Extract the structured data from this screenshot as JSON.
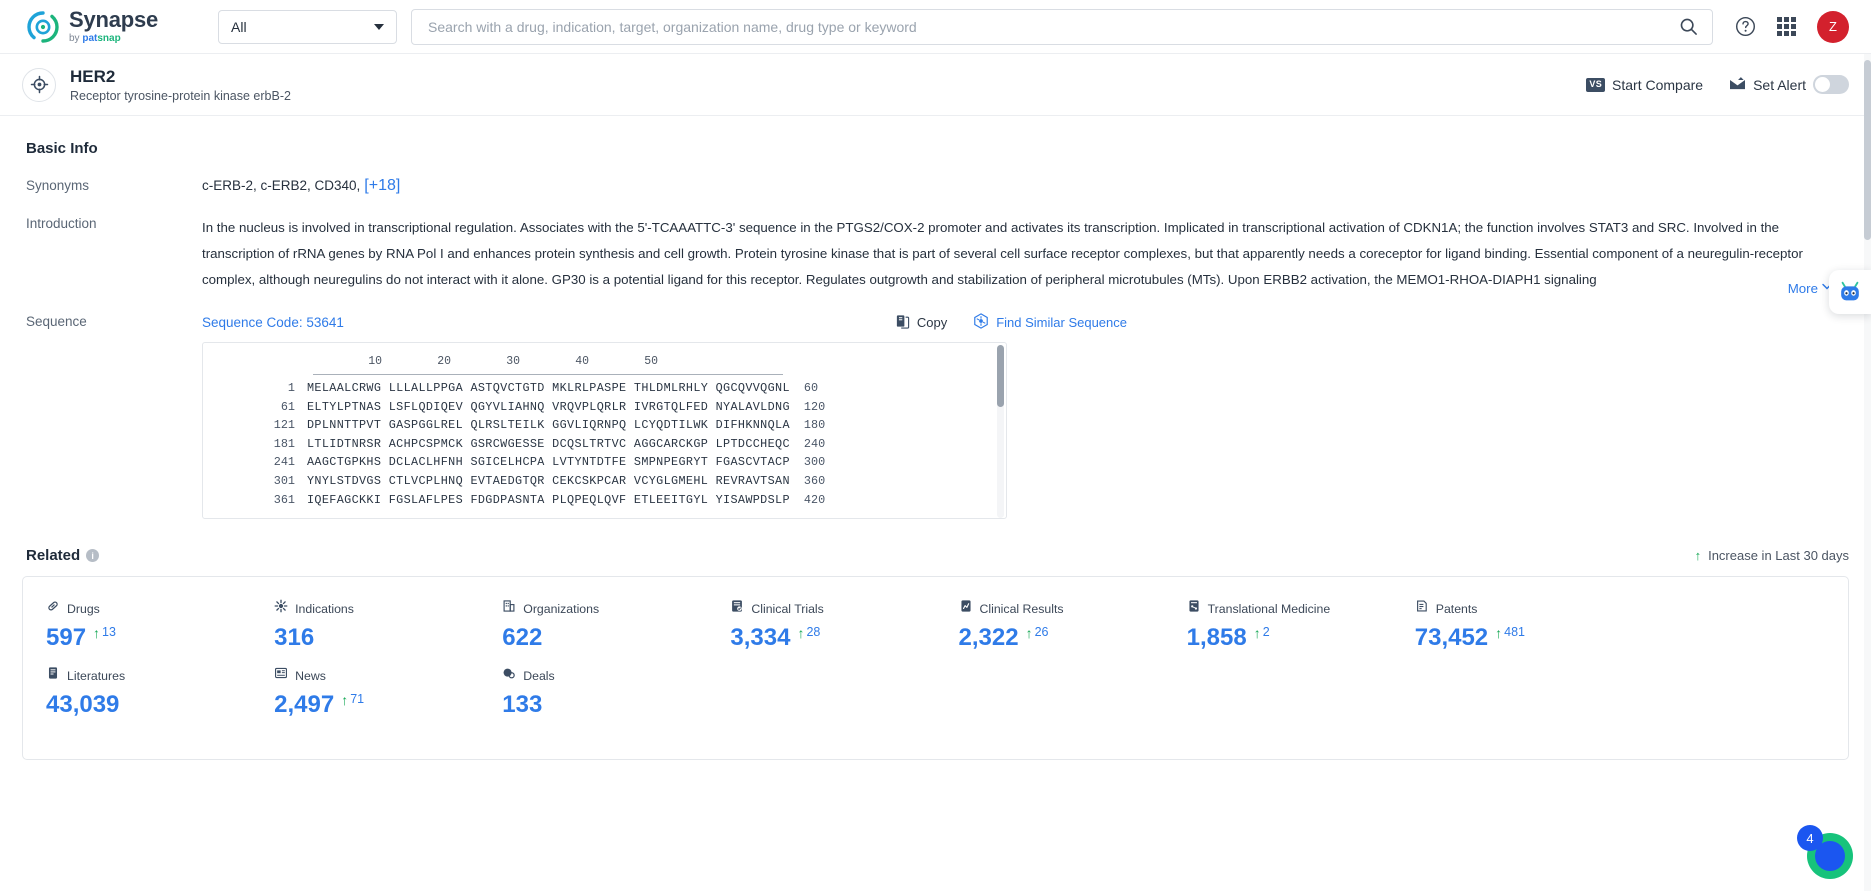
{
  "topbar": {
    "logo_name": "Synapse",
    "logo_by": "by",
    "logo_brand_pat": "pat",
    "logo_brand_snap": "snap",
    "scope_value": "All",
    "search_placeholder": "Search with a drug, indication, target, organization name, drug type or keyword",
    "search_value": "",
    "avatar_initial": "Z"
  },
  "entity": {
    "title": "HER2",
    "subtitle": "Receptor tyrosine-protein kinase erbB-2",
    "compare_badge": "VS",
    "compare_label": "Start Compare",
    "alert_label": "Set Alert"
  },
  "basic_info": {
    "heading": "Basic Info",
    "synonyms_label": "Synonyms",
    "synonyms_value": "c-ERB-2,  c-ERB2,  CD340,",
    "synonyms_more": "[+18]",
    "introduction_label": "Introduction",
    "introduction_text": "In the nucleus is involved in transcriptional regulation. Associates with the 5'-TCAAATTC-3' sequence in the PTGS2/COX-2 promoter and activates its transcription. Implicated in transcriptional activation of CDKN1A; the function involves STAT3 and SRC. Involved in the transcription of rRNA genes by RNA Pol I and enhances protein synthesis and cell growth. Protein tyrosine kinase that is part of several cell surface receptor complexes, but that apparently needs a coreceptor for ligand binding. Essential component of a neuregulin-receptor complex, although neuregulins do not interact with it alone. GP30 is a potential ligand for this receptor. Regulates outgrowth and stabilization of peripheral microtubules (MTs). Upon ERBB2 activation, the MEMO1-RHOA-DIAPH1 signaling",
    "more_label": "More"
  },
  "sequence": {
    "label": "Sequence",
    "code_label": "Sequence Code: 53641",
    "copy_label": "Copy",
    "find_similar_label": "Find Similar Sequence",
    "ruler": "        10        20        30        40        50",
    "rows": [
      {
        "start": "1",
        "residues": "MELAALCRWG LLLALLPPGA ASTQVCTGTD MKLRLPASPE THLDMLRHLY QGCQVVQGNL",
        "end": "60"
      },
      {
        "start": "61",
        "residues": "ELTYLPTNAS LSFLQDIQEV QGYVLIAHNQ VRQVPLQRLR IVRGTQLFED NYALAVLDNG",
        "end": "120"
      },
      {
        "start": "121",
        "residues": "DPLNNTTPVT GASPGGLREL QLRSLTEILK GGVLIQRNPQ LCYQDTILWK DIFHKNNQLA",
        "end": "180"
      },
      {
        "start": "181",
        "residues": "LTLIDTNRSR ACHPCSPMCK GSRCWGESSE DCQSLTRTVC AGGCARCKGP LPTDCCHEQC",
        "end": "240"
      },
      {
        "start": "241",
        "residues": "AAGCTGPKHS DCLACLHFNH SGICELHCPA LVTYNTDTFE SMPNPEGRYT FGASCVTACP",
        "end": "300"
      },
      {
        "start": "301",
        "residues": "YNYLSTDVGS CTLVCPLHNQ EVTAEDGTQR CEKCSKPCAR VCYGLGMEHL REVRAVTSAN",
        "end": "360"
      },
      {
        "start": "361",
        "residues": "IQEFAGCKKI FGSLAFLPES FDGDPASNTA PLQPEQLQVF ETLEEITGYL YISAWPDSLP",
        "end": "420"
      }
    ]
  },
  "related": {
    "heading": "Related",
    "info_glyph": "i",
    "legend_text": "Increase in Last 30 days",
    "metrics": [
      {
        "icon": "drugs-icon",
        "label": "Drugs",
        "value": "597",
        "delta": "13"
      },
      {
        "icon": "indications-icon",
        "label": "Indications",
        "value": "316",
        "delta": ""
      },
      {
        "icon": "organizations-icon",
        "label": "Organizations",
        "value": "622",
        "delta": ""
      },
      {
        "icon": "clinical-trials-icon",
        "label": "Clinical Trials",
        "value": "3,334",
        "delta": "28"
      },
      {
        "icon": "clinical-results-icon",
        "label": "Clinical Results",
        "value": "2,322",
        "delta": "26"
      },
      {
        "icon": "translational-medicine-icon",
        "label": "Translational Medicine",
        "value": "1,858",
        "delta": "2"
      },
      {
        "icon": "patents-icon",
        "label": "Patents",
        "value": "73,452",
        "delta": "481"
      },
      {
        "icon": "spacer",
        "label": "",
        "value": "",
        "delta": ""
      },
      {
        "icon": "literatures-icon",
        "label": "Literatures",
        "value": "43,039",
        "delta": ""
      },
      {
        "icon": "news-icon",
        "label": "News",
        "value": "2,497",
        "delta": "71"
      },
      {
        "icon": "deals-icon",
        "label": "Deals",
        "value": "133",
        "delta": ""
      }
    ]
  },
  "floating": {
    "corner_badge": "4"
  },
  "colors": {
    "accent_blue": "#2f7be8",
    "increase_green": "#18a957",
    "avatar_red": "#d3212d"
  }
}
